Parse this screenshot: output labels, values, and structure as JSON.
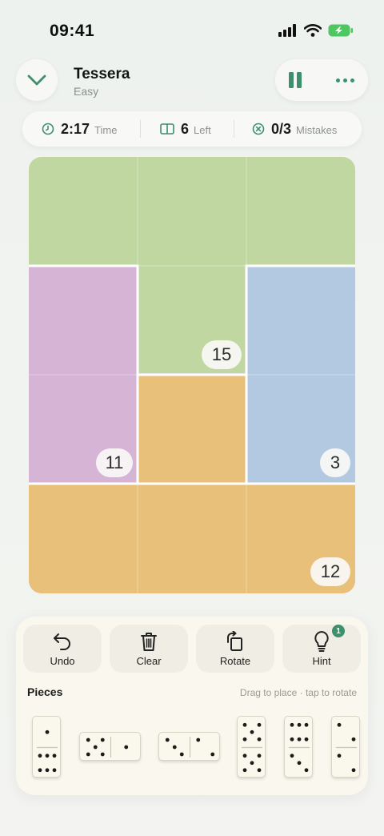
{
  "status_bar": {
    "time": "09:41",
    "icons": [
      "signal-icon",
      "wifi-icon",
      "battery-charging-icon"
    ]
  },
  "header": {
    "title": "Tessera",
    "difficulty": "Easy"
  },
  "stats": {
    "time_value": "2:17",
    "time_label": "Time",
    "left_value": "6",
    "left_label": "Left",
    "mistakes_value": "0/3",
    "mistakes_label": "Mistakes"
  },
  "board": {
    "columns": 3,
    "rows": 4,
    "regions": [
      {
        "name": "green",
        "color": "#c1d7a2",
        "sum": "15"
      },
      {
        "name": "purple",
        "color": "#d5b4d6",
        "sum": "11"
      },
      {
        "name": "blue",
        "color": "#b3c9e2",
        "sum": "3"
      },
      {
        "name": "orange",
        "color": "#e9c07a",
        "sum": "12"
      }
    ]
  },
  "toolbar": {
    "undo_label": "Undo",
    "clear_label": "Clear",
    "rotate_label": "Rotate",
    "hint_label": "Hint",
    "hint_count": "1"
  },
  "pieces": {
    "title": "Pieces",
    "hint": "Drag to place · tap to rotate",
    "items": [
      {
        "orientation": "vertical",
        "pips": [
          1,
          6
        ]
      },
      {
        "orientation": "horizontal",
        "pips": [
          5,
          1
        ]
      },
      {
        "orientation": "horizontal",
        "pips": [
          3,
          2
        ]
      },
      {
        "orientation": "vertical",
        "pips": [
          5,
          5
        ]
      },
      {
        "orientation": "vertical",
        "pips": [
          6,
          3
        ]
      },
      {
        "orientation": "vertical",
        "pips": [
          2,
          2
        ]
      }
    ]
  },
  "colors": {
    "accent": "#3e8f6c",
    "pip": "#1b1b1b"
  }
}
